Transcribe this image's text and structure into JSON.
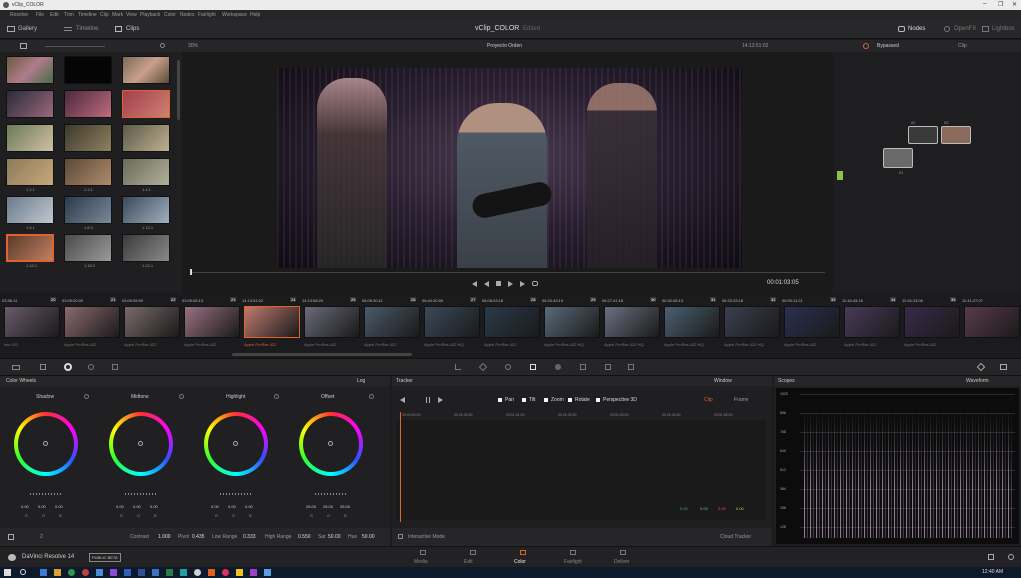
{
  "window": {
    "title": "vClip_COLOR",
    "controls": [
      "–",
      "❐",
      "✕"
    ]
  },
  "menu": [
    "Resolve",
    "File",
    "Edit",
    "Trim",
    "Timeline",
    "Clip",
    "Mark",
    "View",
    "Playback",
    "Color",
    "Nodes",
    "Fairlight",
    "Workspace",
    "Help"
  ],
  "topbar": {
    "gallery": "Gallery",
    "timeline": "Timeline",
    "clips": "Clips",
    "project_title": "vClip_COLOR",
    "status": "Edited",
    "nodes": "Nodes",
    "openfx": "OpenFX",
    "lightbox": "Lightbox"
  },
  "viewer": {
    "zoom": "30%",
    "order": "Proyecto Orden",
    "timecode_top": "14:13:51:02",
    "bypass": "Bypassed",
    "clip_label": "Clip",
    "timecode": "00:01:03:05"
  },
  "gallery": {
    "captions": [
      "1.2.1",
      "1.3.1",
      "1.4.1",
      "1.6.1",
      "1.8.3",
      "1.12.1",
      "1.16.1",
      "1.18.2",
      "1.22.1"
    ]
  },
  "nodes": {
    "labels": [
      "01",
      "02",
      "03"
    ]
  },
  "timeline": {
    "timecodes": [
      "03:36:11",
      "03:09:00:00",
      "03:09:05:09",
      "03:09:06:13",
      "14:13:51:02",
      "14:13:58:20",
      "06:09:30:11",
      "06:40:30:05",
      "06:08:03:18",
      "06:20:43:19",
      "06:27:41:18",
      "06:32:08:13",
      "06:33:33:18",
      "06:00:11:21",
      "11:46:43:16",
      "11:34:13:06",
      "11:41:27:07"
    ],
    "numbers": [
      "20",
      "21",
      "22",
      "23",
      "24",
      "25",
      "26",
      "27",
      "28",
      "29",
      "30",
      "31",
      "32",
      "33",
      "34",
      "35"
    ],
    "codecs": [
      "ires 422",
      "Apple ProRes 422",
      "Apple ProRes 422",
      "Apple ProRes 422",
      "Apple ProRes 422",
      "Apple ProRes 422",
      "Apple ProRes 422",
      "Apple ProRes 422 HQ",
      "Apple ProRes 422",
      "Apple ProRes 422 HQ",
      "Apple ProRes 422 HQ",
      "Apple ProRes 422 HQ",
      "Apple ProRes 422 HQ",
      "Apple ProRes 422",
      "Apple ProRes 422",
      "Apple ProRes 422"
    ]
  },
  "wheels": {
    "title": "Color Wheels",
    "mode": "Log",
    "items": [
      {
        "label": "Shadow",
        "values": [
          "0.00",
          "0.00",
          "0.00"
        ],
        "channels": [
          "R",
          "G",
          "B"
        ]
      },
      {
        "label": "Midtone",
        "values": [
          "0.00",
          "0.00",
          "0.00"
        ],
        "channels": [
          "R",
          "G",
          "B"
        ]
      },
      {
        "label": "Highlight",
        "values": [
          "0.00",
          "0.00",
          "0.00"
        ],
        "channels": [
          "R",
          "G",
          "B"
        ]
      },
      {
        "label": "Offset",
        "values": [
          "25.00",
          "25.00",
          "25.00"
        ],
        "channels": [
          "R",
          "G",
          "B"
        ]
      }
    ],
    "footer": {
      "page": "2",
      "contrast_label": "Contrast",
      "contrast": "1.000",
      "pivot_label": "Pivot",
      "pivot": "0.435",
      "low_range_label": "Low Range",
      "low_range": "0.333",
      "high_range_label": "High Range",
      "high_range": "0.550",
      "sat_label": "Sat",
      "sat": "50.00",
      "hue_label": "Hue",
      "hue": "50.00"
    }
  },
  "tracker": {
    "title": "Tracker",
    "window": "Window",
    "options": [
      "Pan",
      "Tilt",
      "Zoom",
      "Rotate",
      "Perspective 3D"
    ],
    "clip": "Clip",
    "frame": "Frame",
    "ruler": [
      "00:00:00:00",
      "00:01:00:00",
      "00:01:01:00",
      "00:01:02:00",
      "00:01:03:00",
      "00:01:04:00",
      "00:01:05:00"
    ],
    "values": [
      "0.00",
      "0.00",
      "0.00",
      "0.00"
    ],
    "interactive": "Interactive Mode",
    "cloud": "Cloud Tracker"
  },
  "scopes": {
    "title": "Scopes",
    "type": "Waveform",
    "scale": [
      "1023",
      "896",
      "768",
      "640",
      "512",
      "384",
      "256",
      "128"
    ]
  },
  "pages": [
    "Media",
    "Edit",
    "Color",
    "Fairlight",
    "Deliver"
  ],
  "active_page": "Color",
  "app": {
    "name": "DaVinci Resolve 14",
    "badge": "PUBLIC BETA"
  },
  "taskbar": {
    "clock": "12:40 AM"
  },
  "colors": {
    "accent": "#e0622d",
    "active": "#f09050",
    "check": "#f3f3f3"
  }
}
